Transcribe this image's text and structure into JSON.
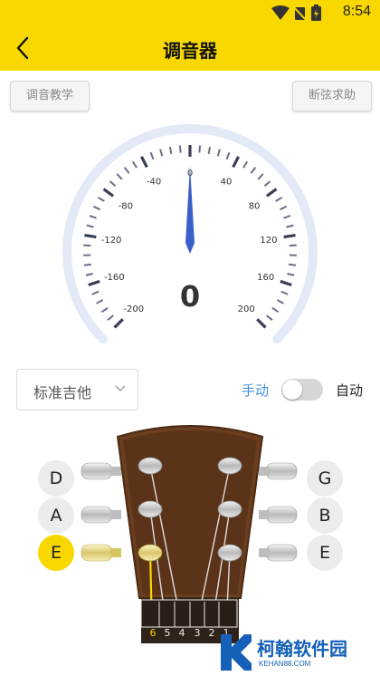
{
  "status_bar": {
    "time": "8:54",
    "icons": [
      "wifi-icon",
      "no-sim-icon",
      "battery-icon"
    ]
  },
  "header": {
    "title": "调音器",
    "back_icon": "back-arrow-icon"
  },
  "buttons": {
    "tutorial": "调音教学",
    "broken_string_help": "断弦求助"
  },
  "tuner": {
    "reading": "0",
    "needle_value": 0,
    "scale_labels": [
      "-200",
      "-160",
      "-120",
      "-80",
      "-40",
      "0",
      "40",
      "80",
      "120",
      "160",
      "200"
    ]
  },
  "tuning_select": {
    "selected": "标准吉他"
  },
  "mode": {
    "manual": "手动",
    "auto": "自动",
    "auto_enabled": false
  },
  "strings": {
    "left": [
      {
        "note": "D",
        "active": false
      },
      {
        "note": "A",
        "active": false
      },
      {
        "note": "E",
        "active": true
      }
    ],
    "right": [
      {
        "note": "G",
        "active": false
      },
      {
        "note": "B",
        "active": false
      },
      {
        "note": "E",
        "active": false
      }
    ],
    "nut_numbers": [
      "6",
      "5",
      "4",
      "3",
      "2",
      "1"
    ],
    "selected_string": "6"
  },
  "watermark": {
    "name": "柯翰软件园",
    "url": "KEHAN88.COM"
  },
  "colors": {
    "accent": "#f8d800",
    "link_blue": "#3f8fe0",
    "needle": "#3a5fc8",
    "arc": "#e3e9f6",
    "wood": "#6a3e1f"
  }
}
